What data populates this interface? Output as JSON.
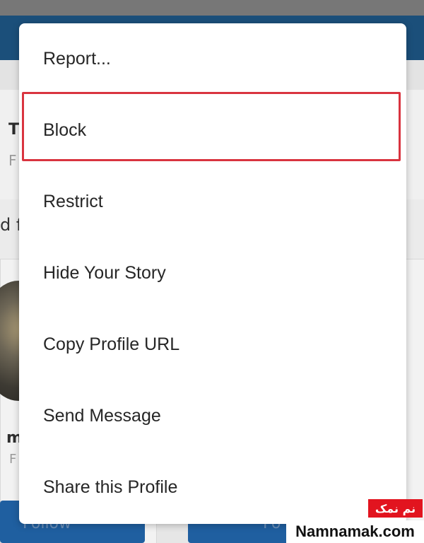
{
  "background": {
    "profile_initial": "T",
    "profile_sub": "F",
    "section_fragment": "d f",
    "card_name": "m",
    "card_sub": "F",
    "follow_button_left": "Follow",
    "follow_button_right": "Fo"
  },
  "menu": {
    "items": [
      {
        "label": "Report..."
      },
      {
        "label": "Block"
      },
      {
        "label": "Restrict"
      },
      {
        "label": "Hide Your Story"
      },
      {
        "label": "Copy Profile URL"
      },
      {
        "label": "Send Message"
      },
      {
        "label": "Share this Profile"
      }
    ],
    "highlighted_item": "Block",
    "highlight_color": "#d9343f"
  },
  "watermark": {
    "badge_text": "نم نمک",
    "site_text": "Namnamak.com",
    "badge_color": "#e2141f"
  }
}
